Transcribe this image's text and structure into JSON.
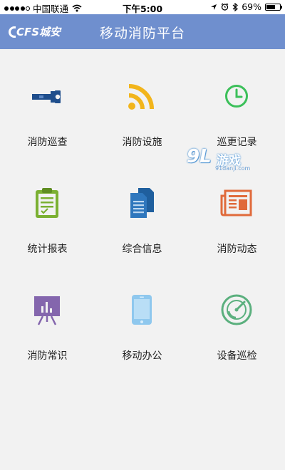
{
  "status_bar": {
    "carrier": "中国联通",
    "time": "下午5:00",
    "battery": "69%",
    "battery_level": 0.69,
    "icons": [
      "signal-icon",
      "wifi-icon",
      "location-icon",
      "alarm-icon",
      "bluetooth-icon",
      "battery-icon"
    ]
  },
  "nav": {
    "logo_text": "CFS城安",
    "title": "移动消防平台"
  },
  "menu": [
    {
      "label": "消防巡查",
      "icon": "flashlight-icon",
      "color": "#1f4e8c"
    },
    {
      "label": "消防设施",
      "icon": "rss-icon",
      "color": "#f2b51c"
    },
    {
      "label": "巡更记录",
      "icon": "clock-icon",
      "color": "#3cc05a"
    },
    {
      "label": "统计报表",
      "icon": "clipboard-icon",
      "color": "#7bb032"
    },
    {
      "label": "综合信息",
      "icon": "documents-icon",
      "color": "#1f5f9e"
    },
    {
      "label": "消防动态",
      "icon": "newspaper-icon",
      "color": "#e06a3b"
    },
    {
      "label": "消防常识",
      "icon": "presentation-icon",
      "color": "#8466ad"
    },
    {
      "label": "移动办公",
      "icon": "tablet-icon",
      "color": "#8fc8ee"
    },
    {
      "label": "设备巡检",
      "icon": "radar-icon",
      "color": "#5bb07e"
    }
  ],
  "watermark": {
    "brand": "9L",
    "brand_cn": "游戏",
    "url": "91danji.com"
  },
  "colors": {
    "nav_bg": "#6f8fce",
    "page_bg": "#f2f2f2"
  }
}
